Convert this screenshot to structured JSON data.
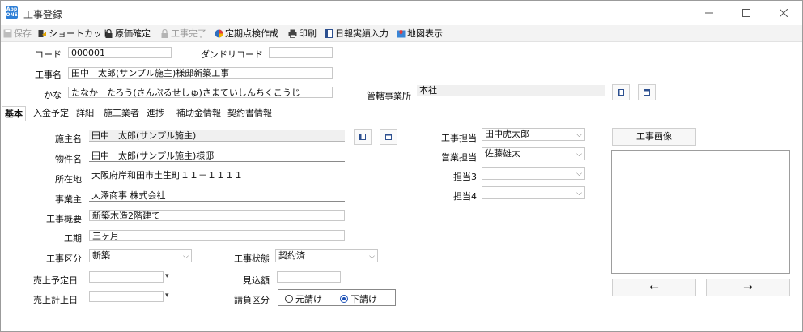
{
  "window": {
    "title": "工事登録",
    "app_icon_text": "App ONE",
    "minimize_label": "—",
    "maximize_label": "☐",
    "close_label": "✕"
  },
  "toolbar": {
    "items": [
      {
        "label": "保存",
        "icon": "save-icon",
        "disabled": true
      },
      {
        "label": "ショートカット",
        "icon": "shortcut-icon",
        "disabled": false
      },
      {
        "label": "原価確定",
        "icon": "lock-icon",
        "disabled": false
      },
      {
        "label": "工事完了",
        "icon": "lock-icon",
        "disabled": true
      },
      {
        "label": "定期点検作成",
        "icon": "inspection-icon",
        "disabled": false
      },
      {
        "label": "印刷",
        "icon": "printer-icon",
        "disabled": false
      },
      {
        "label": "日報実績入力",
        "icon": "book-icon",
        "disabled": false
      },
      {
        "label": "地図表示",
        "icon": "map-icon",
        "disabled": false
      }
    ]
  },
  "header": {
    "code_label": "コード",
    "code_value": "000001",
    "dandori_label": "ダンドリコード",
    "dandori_value": "",
    "name_label": "工事名",
    "name_value": "田中　太郎(サンプル施主)様邸新築工事",
    "kana_label": "かな",
    "kana_value": "たなか　たろう(さんぷるせしゅ)さまていしんちくこうじ",
    "office_label": "管轄事業所",
    "office_value": "本社"
  },
  "tabs": [
    {
      "label": "基本",
      "active": true
    },
    {
      "label": "入金予定",
      "active": false
    },
    {
      "label": "詳細",
      "active": false
    },
    {
      "label": "施工業者",
      "active": false
    },
    {
      "label": "進捗",
      "active": false
    },
    {
      "label": "補助金情報",
      "active": false
    },
    {
      "label": "契約書情報",
      "active": false
    }
  ],
  "basic": {
    "owner_label": "施主名",
    "owner_value": "田中　太郎(サンプル施主)",
    "property_label": "物件名",
    "property_value": "田中　太郎(サンプル施主)様邸",
    "address_label": "所在地",
    "address_value": "大阪府岸和田市土生町１１－１１１１",
    "client_label": "事業主",
    "client_value": "大澤商事 株式会社",
    "summary_label": "工事概要",
    "summary_value": "新築木造2階建て",
    "period_label": "工期",
    "period_value": "三ヶ月",
    "category_label": "工事区分",
    "category_value": "新築",
    "status_label": "工事状態",
    "status_value": "契約済",
    "sales_plan_label": "売上予定日",
    "sales_plan_value": "",
    "estimate_label": "見込額",
    "estimate_value": "",
    "sales_post_label": "売上計上日",
    "sales_post_value": "",
    "contract_label": "請負区分",
    "contract_options": [
      {
        "label": "元請け",
        "selected": false
      },
      {
        "label": "下請け",
        "selected": true
      }
    ]
  },
  "staff": {
    "construction_label": "工事担当",
    "construction_value": "田中虎太郎",
    "sales_label": "営業担当",
    "sales_value": "佐藤雄太",
    "staff3_label": "担当3",
    "staff3_value": "",
    "staff4_label": "担当4",
    "staff4_value": ""
  },
  "image_panel": {
    "button_label": "工事画像",
    "prev_label": "←",
    "next_label": "→"
  },
  "colors": {
    "accent": "#2e7fd6",
    "radio_selected": "#1a4fb5"
  }
}
